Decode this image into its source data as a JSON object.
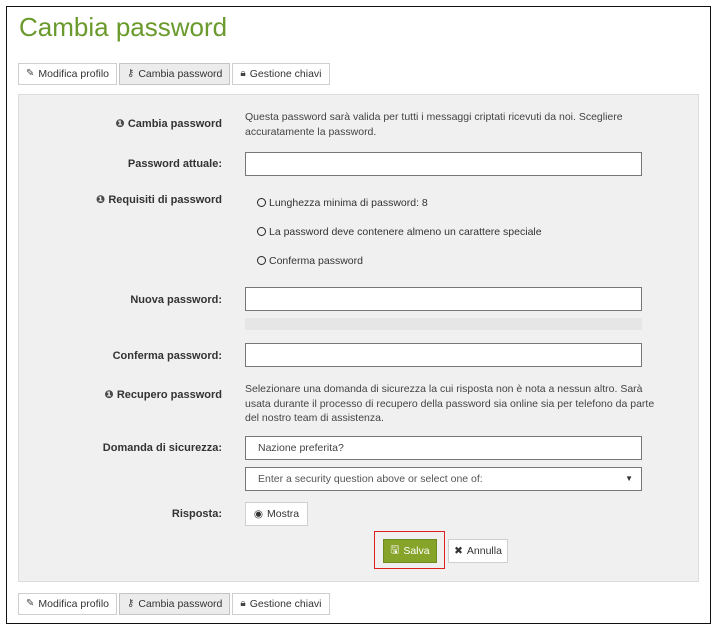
{
  "page": {
    "title": "Cambia password"
  },
  "tabs": [
    {
      "label": "Modifica profilo",
      "icon": "pencil-icon"
    },
    {
      "label": "Cambia password",
      "icon": "key-icon",
      "active": true
    },
    {
      "label": "Gestione chiavi",
      "icon": "lock-icon"
    }
  ],
  "form": {
    "intro_label": "Cambia password",
    "intro_help": "Questa password sarà valida per tutti i messaggi criptati ricevuti da noi. Scegliere accuratamente la password.",
    "current_password_label": "Password attuale:",
    "requirements_label": "Requisiti di password",
    "requirements": [
      "Lunghezza minima di password: 8",
      "La password deve contenere almeno un carattere speciale",
      "Conferma password"
    ],
    "new_password_label": "Nuova password:",
    "confirm_password_label": "Conferma password:",
    "recovery_label": "Recupero password",
    "recovery_help": "Selezionare una domanda di sicurezza la cui risposta non è nota a nessun altro. Sarà usata durante il processo di recupero della password sia online sia per telefono da parte del nostro team di assistenza.",
    "security_question_label": "Domanda di sicurezza:",
    "security_question_value": "Nazione preferita?",
    "security_question_select": "Enter a security question above or select one of:",
    "answer_label": "Risposta:",
    "show_label": "Mostra",
    "save_label": "Salva",
    "cancel_label": "Annulla"
  },
  "colors": {
    "title": "#6a9a2c",
    "save_button": "#86a32a",
    "highlight": "#e02020"
  }
}
